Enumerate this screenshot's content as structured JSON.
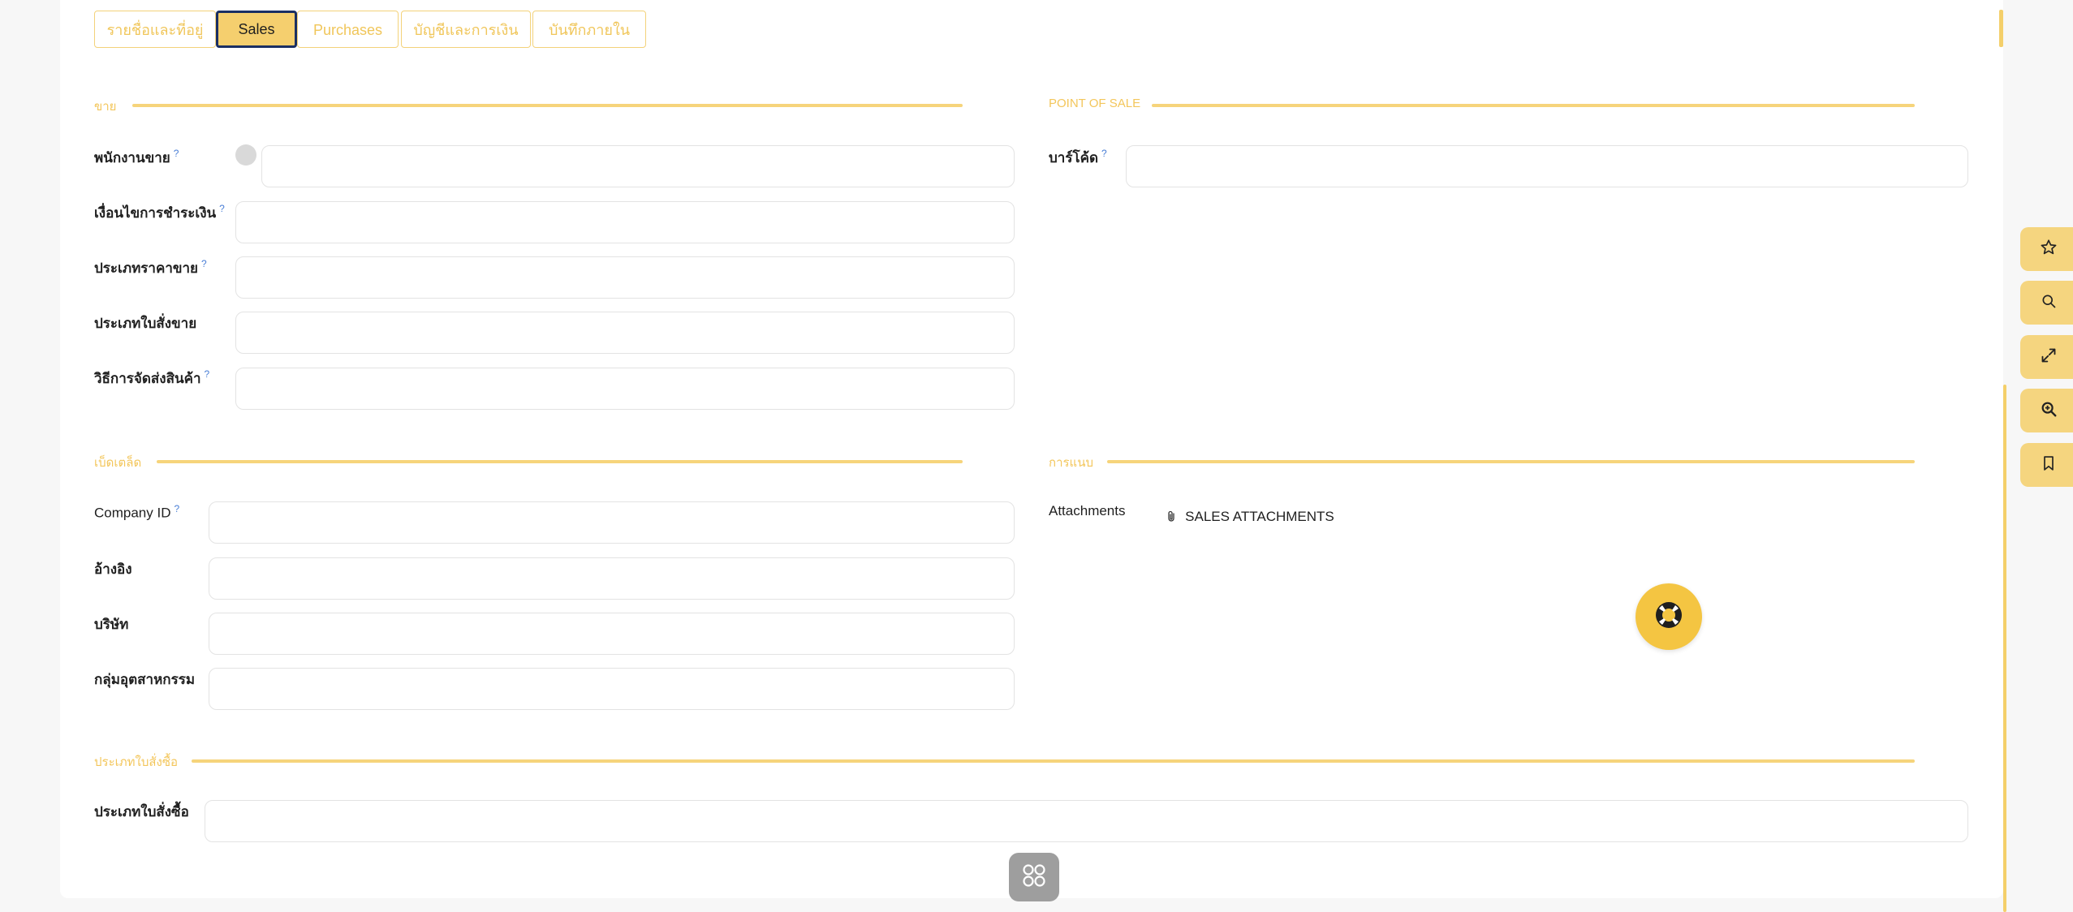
{
  "tabs": [
    {
      "label": "รายชื่อและที่อยู่",
      "active": false
    },
    {
      "label": "Sales",
      "active": true
    },
    {
      "label": "Purchases",
      "active": false
    },
    {
      "label": "บัญชีและการเงิน",
      "active": false
    },
    {
      "label": "บันทึกภายใน",
      "active": false
    }
  ],
  "sales_section": {
    "title": "ขาย",
    "fields": [
      {
        "label": "พนักงานขาย",
        "help": "?",
        "value": ""
      },
      {
        "label": "เงื่อนไขการชำระเงิน",
        "help": "?",
        "value": ""
      },
      {
        "label": "ประเภทราคาขาย",
        "help": "?",
        "value": ""
      },
      {
        "label": "ประเภทใบสั่งขาย",
        "value": ""
      },
      {
        "label": "วิธีการจัดส่งสินค้า",
        "help": "?",
        "value": ""
      }
    ]
  },
  "pos_section": {
    "title": "POINT OF SALE",
    "fields": [
      {
        "label": "บาร์โค้ด",
        "help": "?",
        "value": ""
      }
    ]
  },
  "misc_section": {
    "title": "เบ็ดเตล็ด",
    "fields": [
      {
        "label": "Company ID",
        "help": "?",
        "value": ""
      },
      {
        "label": "อ้างอิง",
        "value": ""
      },
      {
        "label": "บริษัท",
        "value": ""
      },
      {
        "label": "กลุ่มอุตสาหกรรม",
        "value": ""
      }
    ]
  },
  "attach_section": {
    "title": "การแนบ",
    "label": "Attachments",
    "button": "SALES ATTACHMENTS"
  },
  "purchase_section": {
    "title": "ประเภทใบสั่งซื้อ",
    "fields": [
      {
        "label": "ประเภทใบสั่งซื้อ",
        "value": ""
      }
    ]
  },
  "rail": {
    "icons": [
      "star-icon",
      "search-icon",
      "expand-icon",
      "zoom-in-icon",
      "bookmark-icon"
    ]
  },
  "colors": {
    "accent": "#f5cf6e",
    "active_tab_border": "#1a2f63",
    "section_line": "#f6d47b",
    "help_fab": "#f4c542"
  }
}
